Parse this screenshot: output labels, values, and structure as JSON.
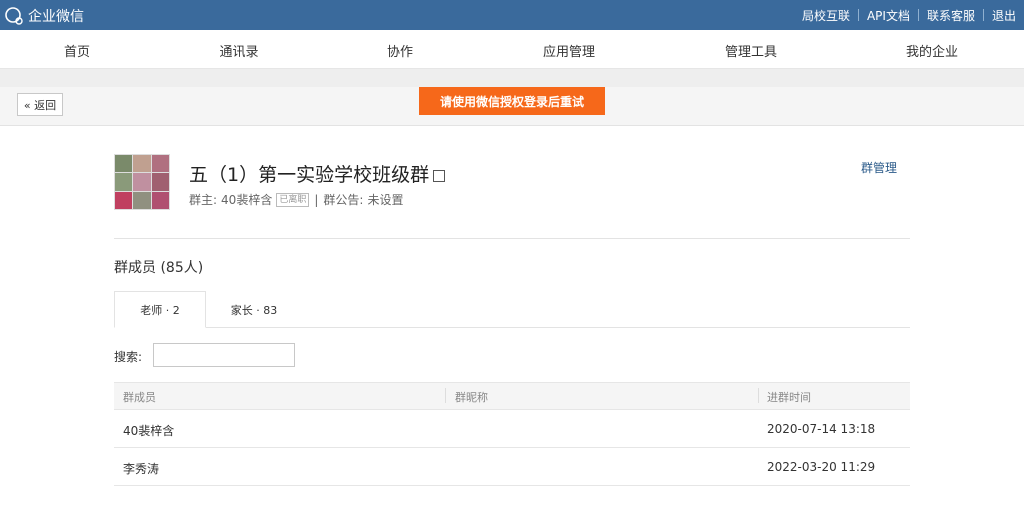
{
  "topbar": {
    "logo_text": "企业微信",
    "links": [
      "局校互联",
      "API文档",
      "联系客服",
      "退出"
    ]
  },
  "nav": {
    "items": [
      "首页",
      "通讯录",
      "协作",
      "应用管理",
      "管理工具",
      "我的企业"
    ]
  },
  "toolbar": {
    "back_label": "« 返回",
    "alert_text": "请使用微信授权登录后重试"
  },
  "group": {
    "title": "五（1）第一实验学校班级群",
    "owner_label": "群主:",
    "owner_name": "40裴梓含",
    "owner_tag": "已离职",
    "separator": "|",
    "notice_label": "群公告:",
    "notice_value": "未设置",
    "manage_label": "群管理"
  },
  "members": {
    "title": "群成员 (85人)",
    "tabs": [
      "老师 · 2",
      "家长 · 83"
    ],
    "search_label": "搜索:",
    "search_value": "",
    "columns": [
      "群成员",
      "群昵称",
      "进群时间"
    ],
    "rows": [
      {
        "member": "40裴梓含",
        "nickname": "",
        "joined": "2020-07-14 13:18"
      },
      {
        "member": "李秀涛",
        "nickname": "",
        "joined": "2022-03-20 11:29"
      }
    ]
  },
  "colors": {
    "topbar": "#3a6a9c",
    "alert": "#f6681a",
    "link": "#2b5b8a"
  },
  "icons": {
    "logo": "chat-bubble-icon",
    "qr": "qr-code-icon",
    "back": "double-chevron-left-icon"
  }
}
